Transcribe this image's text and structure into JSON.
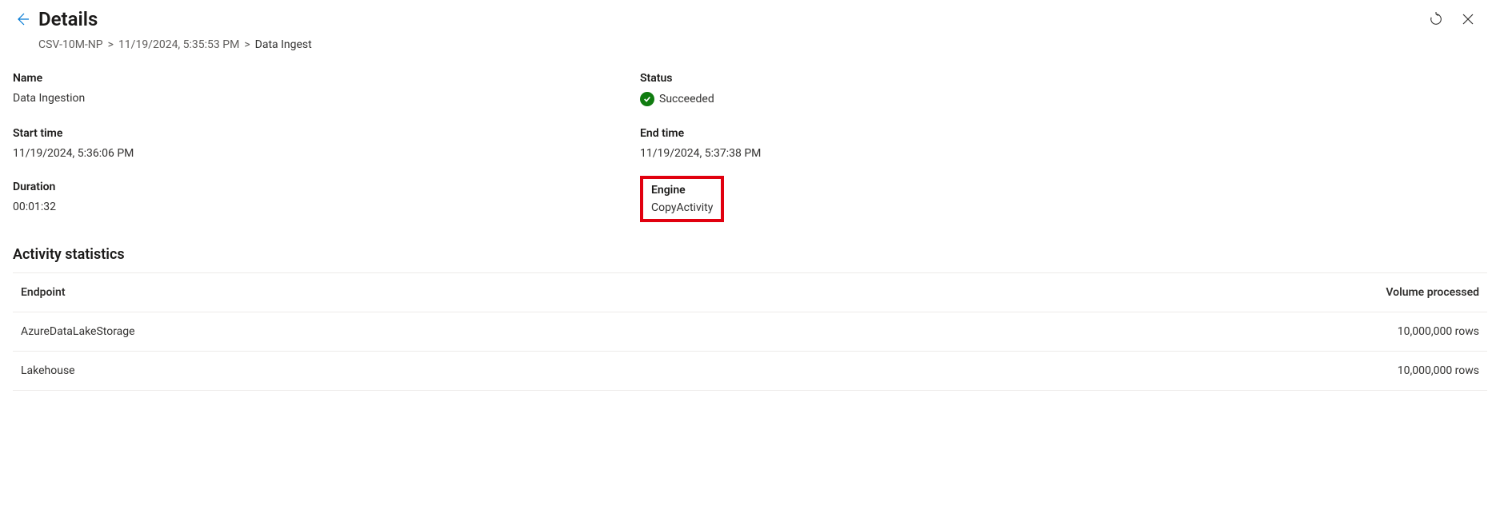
{
  "header": {
    "title": "Details"
  },
  "breadcrumb": {
    "item0": "CSV-10M-NP",
    "item1": "11/19/2024, 5:35:53 PM",
    "current": "Data Ingest",
    "sep": ">"
  },
  "fields": {
    "name_label": "Name",
    "name_value": "Data Ingestion",
    "status_label": "Status",
    "status_value": "Succeeded",
    "start_label": "Start time",
    "start_value": "11/19/2024, 5:36:06 PM",
    "end_label": "End time",
    "end_value": "11/19/2024, 5:37:38 PM",
    "duration_label": "Duration",
    "duration_value": "00:01:32",
    "engine_label": "Engine",
    "engine_value": "CopyActivity"
  },
  "stats": {
    "title": "Activity statistics",
    "col_endpoint": "Endpoint",
    "col_volume": "Volume processed",
    "rows": [
      {
        "endpoint": "AzureDataLakeStorage",
        "volume": "10,000,000 rows"
      },
      {
        "endpoint": "Lakehouse",
        "volume": "10,000,000 rows"
      }
    ]
  }
}
